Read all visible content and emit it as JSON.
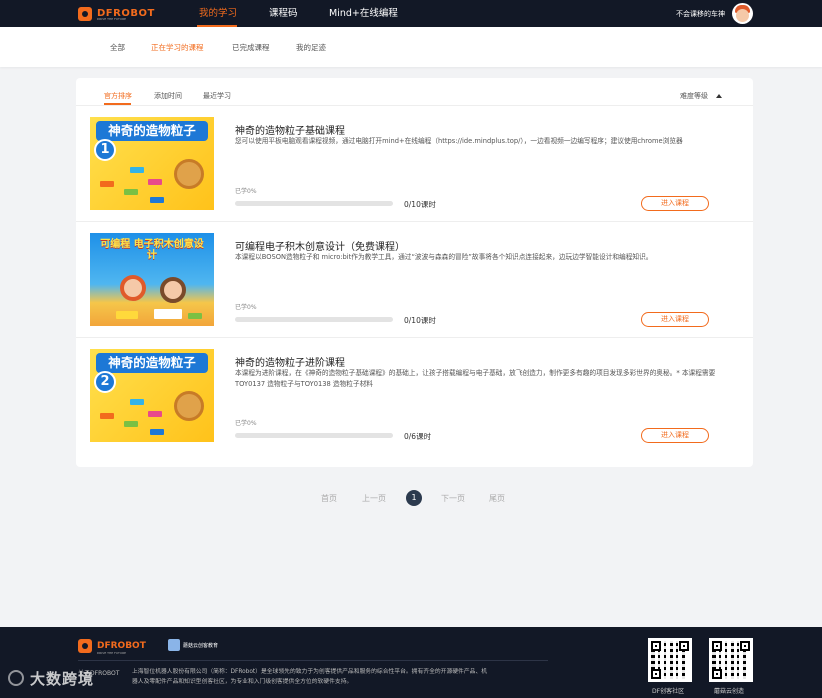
{
  "header": {
    "logo_text": "DFROBOT",
    "logo_sub": "DRIVE THE FUTURE",
    "nav": [
      {
        "label": "我的学习",
        "active": true
      },
      {
        "label": "课程码",
        "active": false
      },
      {
        "label": "Mind+在线编程",
        "active": false
      }
    ],
    "user_name": "不会课移的车神"
  },
  "subnav": {
    "tabs": [
      {
        "label": "全部",
        "active": false
      },
      {
        "label": "正在学习的课程",
        "active": true
      },
      {
        "label": "已完成课程",
        "active": false
      },
      {
        "label": "我的足迹",
        "active": false
      }
    ]
  },
  "sort": {
    "options": [
      {
        "label": "官方排序",
        "active": true
      },
      {
        "label": "添加时间",
        "active": false
      },
      {
        "label": "最近学习",
        "active": false
      }
    ],
    "difficulty_label": "难度等级"
  },
  "courses": [
    {
      "title": "神奇的造物粒子基础课程",
      "description": "您可以使用平板电脑观看课程视频，通过电脑打开mind+在线编程（https://ide.mindplus.top/），一边看视频一边编写程序；建议使用chrome浏览器",
      "progress_label": "已学0%",
      "progress": 0,
      "lessons": "0/10课时",
      "button": "进入课程",
      "thumb_text": "神奇的造物粒子",
      "thumb_number": "1"
    },
    {
      "title": "可编程电子积木创意设计（免费课程）",
      "description": "本课程以BOSON造物粒子和 micro:bit作为教学工具，通过“波波与森森的冒险”故事将各个知识点连接起来，边玩边学智能设计和编程知识。",
      "progress_label": "已学0%",
      "progress": 0,
      "lessons": "0/10课时",
      "button": "进入课程",
      "thumb_text": "可编程 电子积木创意设计",
      "thumb_number": ""
    },
    {
      "title": "神奇的造物粒子进阶课程",
      "description": "本课程为进阶课程，在《神奇的造物粒子基础课程》的基础上，让孩子搭载编程与电子基础，放飞创造力，制作更多有趣的项目发现多彩世界的奥秘。* 本课程需要TOY0137 造物粒子与TOY0138 造物粒子材料",
      "progress_label": "已学0%",
      "progress": 0,
      "lessons": "0/6课时",
      "button": "进入课程",
      "thumb_text": "神奇的造物粒子",
      "thumb_number": "2"
    }
  ],
  "pagination": {
    "first": "首页",
    "prev": "上一页",
    "current": "1",
    "next": "下一页",
    "last": "尾页"
  },
  "footer": {
    "logo_text": "DFROBOT",
    "partner_text": "蘑菇云创客教育",
    "about_title": "关于DFROBOT",
    "about_text": "上海智位机器人股份有限公司（简称：DFRobot）是全球领先的致力于为创客提供产品和服务的综合性平台。拥有齐全的开源硬件产品、机器人及零配件产品和知识型创客社区，为专业和入门级创客提供全方位的软硬件支持。",
    "qr": [
      {
        "label": "DF创客社区"
      },
      {
        "label": "蘑菇云创造"
      }
    ]
  },
  "watermark": "大数跨境",
  "colors": {
    "accent": "#f26b1d",
    "topbar": "#121826",
    "footer": "#121826",
    "page_bg": "#f2f3f5"
  }
}
